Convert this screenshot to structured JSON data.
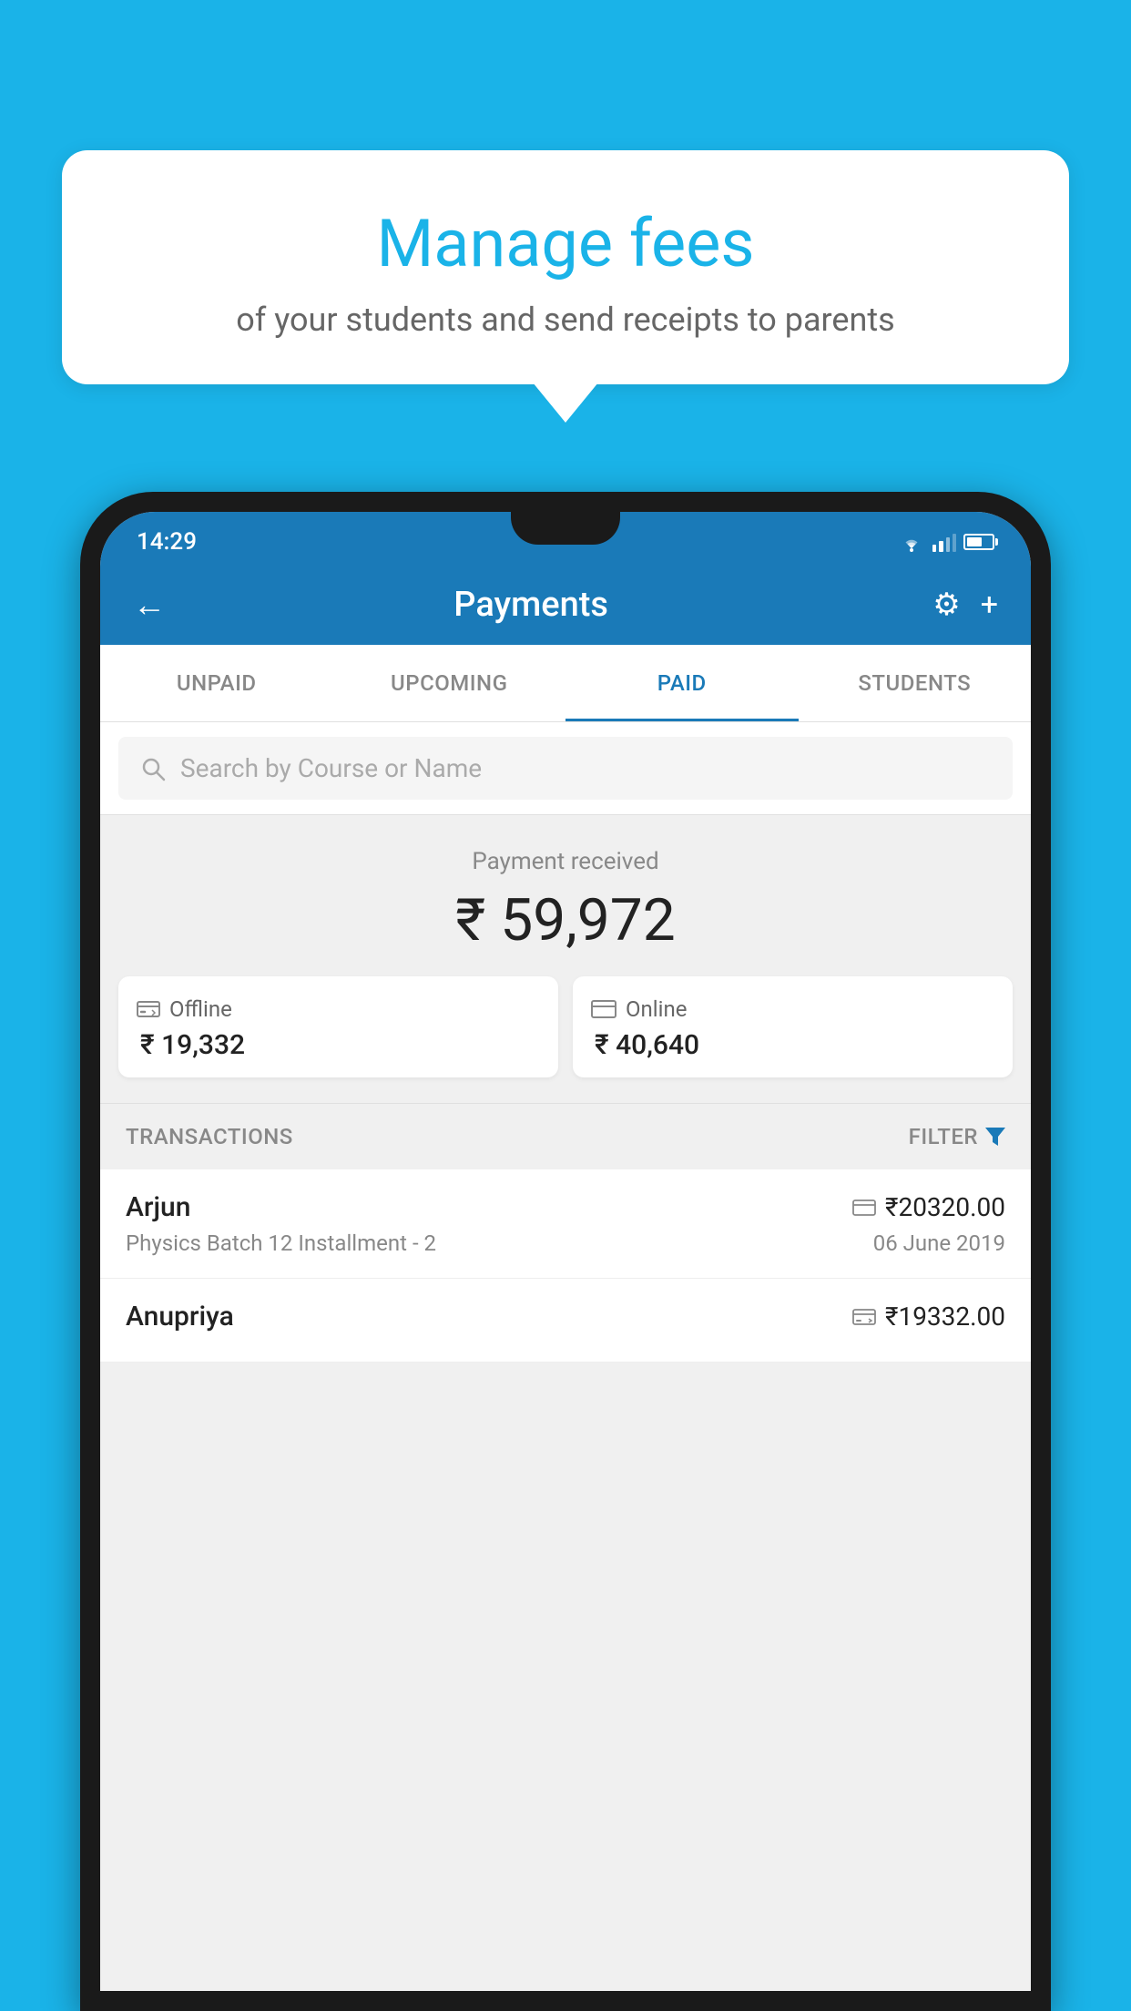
{
  "background_color": "#1ab3e8",
  "speech_bubble": {
    "title": "Manage fees",
    "subtitle": "of your students and send receipts to parents"
  },
  "status_bar": {
    "time": "14:29"
  },
  "header": {
    "title": "Payments",
    "back_label": "←",
    "settings_label": "⚙",
    "add_label": "+"
  },
  "tabs": [
    {
      "id": "unpaid",
      "label": "UNPAID",
      "active": false
    },
    {
      "id": "upcoming",
      "label": "UPCOMING",
      "active": false
    },
    {
      "id": "paid",
      "label": "PAID",
      "active": true
    },
    {
      "id": "students",
      "label": "STUDENTS",
      "active": false
    }
  ],
  "search": {
    "placeholder": "Search by Course or Name"
  },
  "payment_summary": {
    "label": "Payment received",
    "amount": "₹ 59,972",
    "offline": {
      "label": "Offline",
      "amount": "₹ 19,332"
    },
    "online": {
      "label": "Online",
      "amount": "₹ 40,640"
    }
  },
  "transactions_section": {
    "label": "TRANSACTIONS",
    "filter_label": "FILTER"
  },
  "transactions": [
    {
      "name": "Arjun",
      "course": "Physics Batch 12 Installment - 2",
      "amount": "₹20320.00",
      "date": "06 June 2019",
      "type": "online"
    },
    {
      "name": "Anupriya",
      "course": "",
      "amount": "₹19332.00",
      "date": "",
      "type": "offline"
    }
  ]
}
